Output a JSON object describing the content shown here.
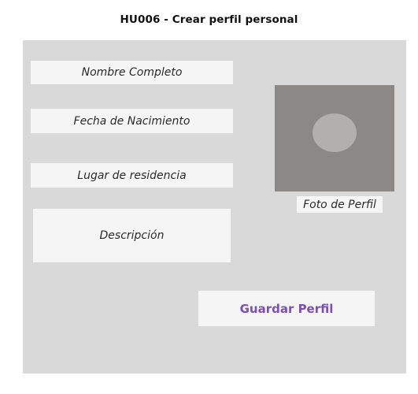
{
  "header": {
    "title": "HU006 - Crear perfil personal"
  },
  "form": {
    "full_name_placeholder": "Nombre Completo",
    "birth_date_placeholder": "Fecha de Nacimiento",
    "residence_placeholder": "Lugar de residencia",
    "description_placeholder": "Descripción"
  },
  "profile_photo": {
    "label": "Foto de Perfil"
  },
  "actions": {
    "save_label": "Guardar Perfil"
  },
  "colors": {
    "panel_background": "#d9d9d9",
    "field_background": "#f5f5f5",
    "photo_background": "#8c8886",
    "accent": "#7b4fb3"
  }
}
